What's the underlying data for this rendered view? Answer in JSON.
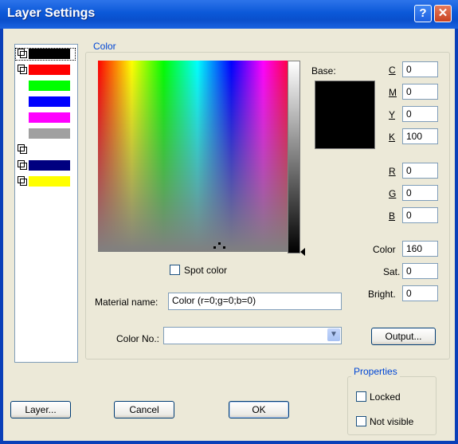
{
  "window": {
    "title": "Layer Settings",
    "help_label": "?",
    "close_label": "✕"
  },
  "layers": [
    {
      "color": "#000000",
      "has_icon": true,
      "selected": true
    },
    {
      "color": "#ff0000",
      "has_icon": true,
      "selected": false
    },
    {
      "color": "#00ff00",
      "has_icon": false,
      "selected": false
    },
    {
      "color": "#0000ff",
      "has_icon": false,
      "selected": false
    },
    {
      "color": "#ff00ff",
      "has_icon": false,
      "selected": false
    },
    {
      "color": "#a0a0a0",
      "has_icon": false,
      "selected": false
    },
    {
      "color": "",
      "has_icon": true,
      "selected": false
    },
    {
      "color": "#000080",
      "has_icon": true,
      "selected": false
    },
    {
      "color": "#ffff00",
      "has_icon": true,
      "selected": false
    }
  ],
  "color_group": {
    "legend": "Color",
    "base_label": "Base:",
    "base_color": "#000000",
    "cmyk": [
      {
        "label": "C",
        "value": "0"
      },
      {
        "label": "M",
        "value": "0"
      },
      {
        "label": "Y",
        "value": "0"
      },
      {
        "label": "K",
        "value": "100"
      }
    ],
    "rgb": [
      {
        "label": "R",
        "value": "0"
      },
      {
        "label": "G",
        "value": "0"
      },
      {
        "label": "B",
        "value": "0"
      }
    ],
    "hsb": [
      {
        "label": "Color",
        "value": "160"
      },
      {
        "label": "Sat.",
        "value": "0"
      },
      {
        "label": "Bright.",
        "value": "0"
      }
    ],
    "spot_color_label": "Spot color",
    "material_name_label": "Material name:",
    "material_name_value": "Color (r=0;g=0;b=0)",
    "color_no_label": "Color No.:",
    "color_no_value": "",
    "output_button": "Output..."
  },
  "properties": {
    "legend": "Properties",
    "locked_label": "Locked",
    "not_visible_label": "Not visible"
  },
  "buttons": {
    "layer": "Layer...",
    "cancel": "Cancel",
    "ok": "OK"
  }
}
